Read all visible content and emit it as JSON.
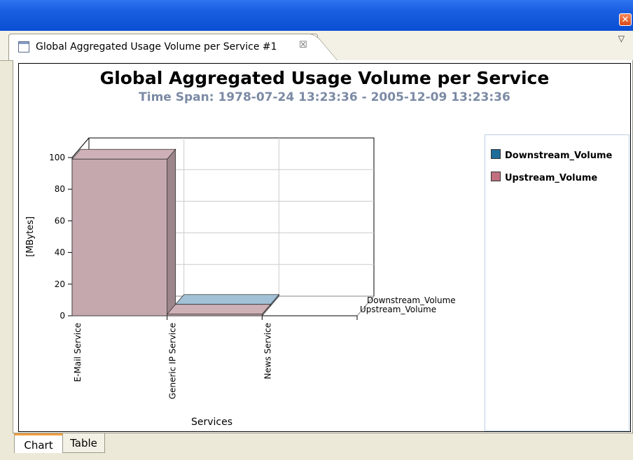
{
  "window": {
    "close_glyph": "✕"
  },
  "tab": {
    "label": "Global Aggregated Usage Volume per Service #1",
    "close_glyph": "☒",
    "view_menu_glyph": "▽"
  },
  "bottom_tabs": [
    {
      "label": "Chart",
      "active": true
    },
    {
      "label": "Table",
      "active": false
    }
  ],
  "chart_data": {
    "type": "bar",
    "title": "Global Aggregated Usage Volume per Service",
    "subtitle": "Time Span: 1978-07-24 13:23:36 - 2005-12-09 13:23:36",
    "xlabel": "Services",
    "ylabel": "[MBytes]",
    "ylim": [
      0,
      100
    ],
    "yticks": [
      0,
      20,
      40,
      60,
      80,
      100
    ],
    "categories": [
      "E-Mail Service",
      "Generic IP Service",
      "News Service"
    ],
    "series": [
      {
        "name": "Upstream_Volume",
        "color": "#c4a8ae",
        "values": [
          99,
          1,
          0
        ]
      },
      {
        "name": "Downstream_Volume",
        "color": "#9ab8cc",
        "values": [
          0,
          1,
          0
        ]
      }
    ],
    "series_labels": [
      "Downstream_Volume",
      "Upstream_Volume"
    ],
    "grid": true,
    "legend_position": "right",
    "legend": [
      {
        "name": "Downstream_Volume",
        "color": "#1f6e9a"
      },
      {
        "name": "Upstream_Volume",
        "color": "#c0707e"
      }
    ]
  }
}
